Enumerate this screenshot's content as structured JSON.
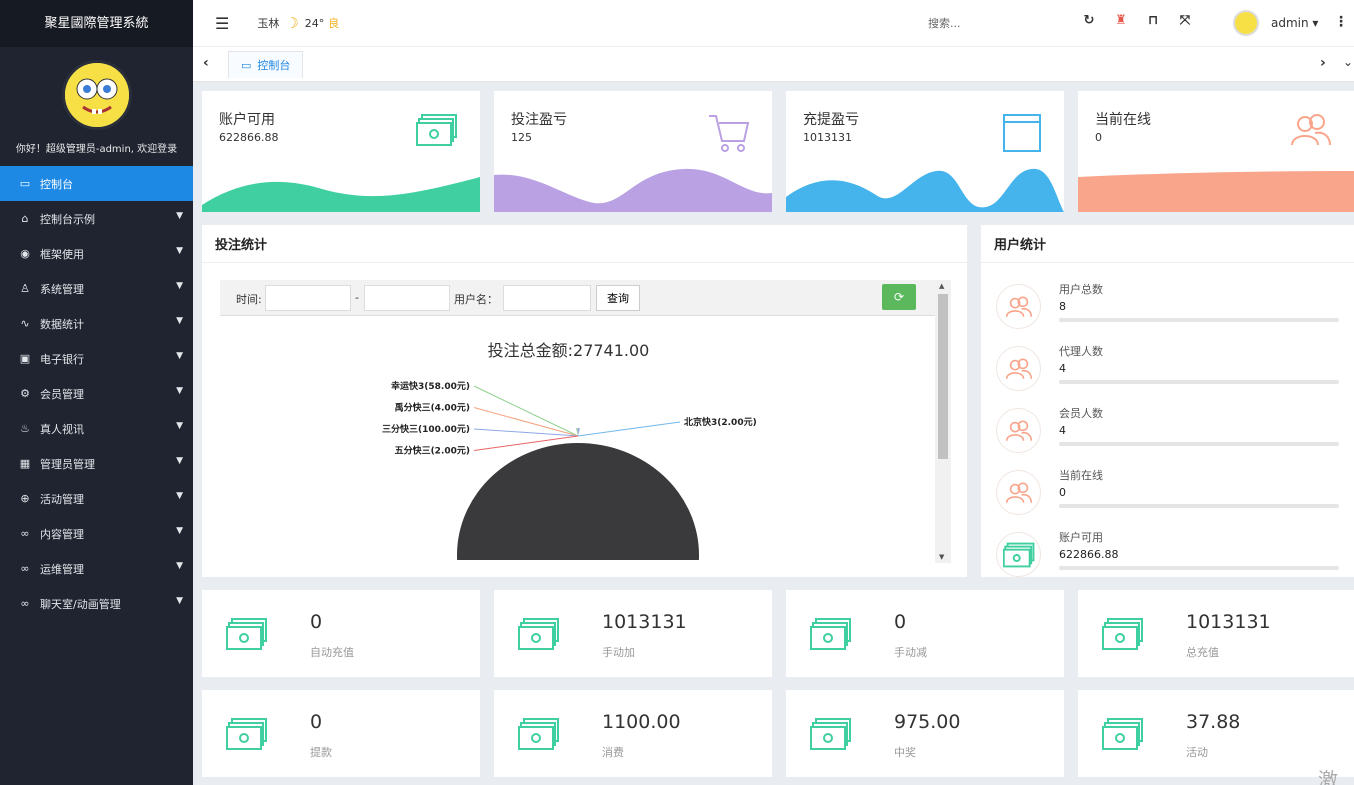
{
  "sidebar": {
    "brand": "聚星國際管理系統",
    "welcome": "你好！超级管理员-admin, 欢迎登录",
    "items": [
      {
        "label": "控制台",
        "icon": "monitor-icon"
      },
      {
        "label": "控制台示例",
        "icon": "home-icon"
      },
      {
        "label": "框架使用",
        "icon": "circle-icon"
      },
      {
        "label": "系统管理",
        "icon": "user-icon"
      },
      {
        "label": "数据统计",
        "icon": "pulse-icon"
      },
      {
        "label": "电子银行",
        "icon": "bank-icon"
      },
      {
        "label": "会员管理",
        "icon": "gear-icon"
      },
      {
        "label": "真人视讯",
        "icon": "fire-icon"
      },
      {
        "label": "管理员管理",
        "icon": "grid-icon"
      },
      {
        "label": "活动管理",
        "icon": "plus-circle-icon"
      },
      {
        "label": "内容管理",
        "icon": "link-icon"
      },
      {
        "label": "运维管理",
        "icon": "link-icon"
      },
      {
        "label": "聊天室/动画管理",
        "icon": "link-icon"
      }
    ]
  },
  "topbar": {
    "city": "玉林",
    "temp": "24°",
    "aqi": "良",
    "search": "搜索...",
    "user": "admin ▾"
  },
  "tabs": {
    "active": "控制台"
  },
  "kpis": [
    {
      "title": "账户可用",
      "value": "622866.88",
      "color": "#3fcfa0"
    },
    {
      "title": "投注盈亏",
      "value": "125",
      "color": "#b9a1e3"
    },
    {
      "title": "充提盈亏",
      "value": "1013131",
      "color": "#45b4ec"
    },
    {
      "title": "当前在线",
      "value": "0",
      "color": "#f9a58b"
    }
  ],
  "bet_panel": {
    "title": "投注统计",
    "time_label": "时间:",
    "dash": "-",
    "user_label": "用户名：",
    "query_btn": "查询",
    "chart_title": "投注总金额:27741.00"
  },
  "chart_data": {
    "type": "pie",
    "title": "投注总金额:27741.00",
    "slices": [
      {
        "label": "幸运快3(58.00元)",
        "value": 58.0
      },
      {
        "label": "禹分快三(4.00元)",
        "value": 4.0
      },
      {
        "label": "三分快三(100.00元)",
        "value": 100.0
      },
      {
        "label": "五分快三(2.00元)",
        "value": 2.0
      },
      {
        "label": "北京快3(2.00元)",
        "value": 2.0
      }
    ]
  },
  "user_panel": {
    "title": "用户统计",
    "rows": [
      {
        "title": "用户总数",
        "value": "8"
      },
      {
        "title": "代理人数",
        "value": "4"
      },
      {
        "title": "会员人数",
        "value": "4"
      },
      {
        "title": "当前在线",
        "value": "0"
      },
      {
        "title": "账户可用",
        "value": "622866.88"
      }
    ]
  },
  "stats": [
    {
      "value": "0",
      "label": "自动充值"
    },
    {
      "value": "1013131",
      "label": "手动加"
    },
    {
      "value": "0",
      "label": "手动减"
    },
    {
      "value": "1013131",
      "label": "总充值"
    },
    {
      "value": "0",
      "label": "提款"
    },
    {
      "value": "1100.00",
      "label": "消费"
    },
    {
      "value": "975.00",
      "label": "中奖"
    },
    {
      "value": "37.88",
      "label": "活动"
    }
  ],
  "watermark": "激活"
}
